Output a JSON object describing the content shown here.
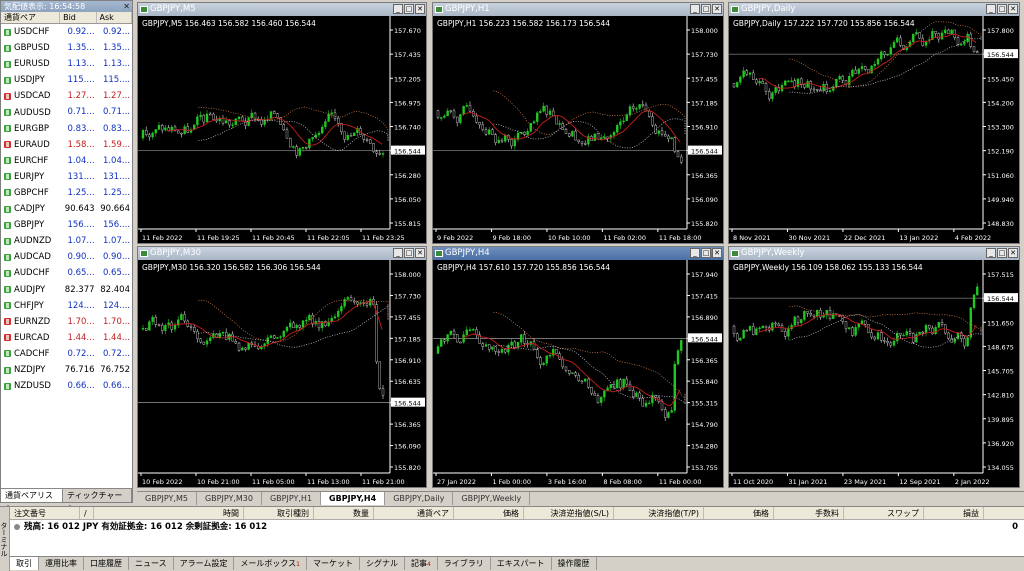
{
  "market_watch": {
    "title": "気配値表示: 16:54:58",
    "col_symbol": "通貨ペア",
    "col_bid": "Bid",
    "col_ask": "Ask",
    "rows": [
      {
        "s": "USDCHF",
        "b": "0.92...",
        "a": "0.92...",
        "dir": "up",
        "col": "blue"
      },
      {
        "s": "GBPUSD",
        "b": "1.35...",
        "a": "1.35...",
        "dir": "up",
        "col": "blue"
      },
      {
        "s": "EURUSD",
        "b": "1.13...",
        "a": "1.13...",
        "dir": "up",
        "col": "blue"
      },
      {
        "s": "USDJPY",
        "b": "115....",
        "a": "115....",
        "dir": "up",
        "col": "blue"
      },
      {
        "s": "USDCAD",
        "b": "1.27...",
        "a": "1.27...",
        "dir": "dn",
        "col": "red"
      },
      {
        "s": "AUDUSD",
        "b": "0.71...",
        "a": "0.71...",
        "dir": "up",
        "col": "blue"
      },
      {
        "s": "EURGBP",
        "b": "0.83...",
        "a": "0.83...",
        "dir": "up",
        "col": "blue"
      },
      {
        "s": "EURAUD",
        "b": "1.58...",
        "a": "1.59...",
        "dir": "dn",
        "col": "red"
      },
      {
        "s": "EURCHF",
        "b": "1.04...",
        "a": "1.04...",
        "dir": "up",
        "col": "blue"
      },
      {
        "s": "EURJPY",
        "b": "131....",
        "a": "131....",
        "dir": "up",
        "col": "blue"
      },
      {
        "s": "GBPCHF",
        "b": "1.25...",
        "a": "1.25...",
        "dir": "up",
        "col": "blue"
      },
      {
        "s": "CADJPY",
        "b": "90.643",
        "a": "90.664",
        "dir": "up",
        "col": "blk"
      },
      {
        "s": "GBPJPY",
        "b": "156....",
        "a": "156....",
        "dir": "up",
        "col": "blue"
      },
      {
        "s": "AUDNZD",
        "b": "1.07...",
        "a": "1.07...",
        "dir": "up",
        "col": "blue"
      },
      {
        "s": "AUDCAD",
        "b": "0.90...",
        "a": "0.90...",
        "dir": "up",
        "col": "blue"
      },
      {
        "s": "AUDCHF",
        "b": "0.65...",
        "a": "0.65...",
        "dir": "up",
        "col": "blue"
      },
      {
        "s": "AUDJPY",
        "b": "82.377",
        "a": "82.404",
        "dir": "up",
        "col": "blk"
      },
      {
        "s": "CHFJPY",
        "b": "124....",
        "a": "124....",
        "dir": "up",
        "col": "blue"
      },
      {
        "s": "EURNZD",
        "b": "1.70...",
        "a": "1.70...",
        "dir": "dn",
        "col": "red"
      },
      {
        "s": "EURCAD",
        "b": "1.44...",
        "a": "1.44...",
        "dir": "dn",
        "col": "red"
      },
      {
        "s": "CADCHF",
        "b": "0.72...",
        "a": "0.72...",
        "dir": "up",
        "col": "blue"
      },
      {
        "s": "NZDJPY",
        "b": "76.716",
        "a": "76.752",
        "dir": "up",
        "col": "blk"
      },
      {
        "s": "NZDUSD",
        "b": "0.66...",
        "a": "0.66...",
        "dir": "up",
        "col": "blue"
      }
    ],
    "tabs": [
      "通貨ペアリスト",
      "ティックチャート"
    ]
  },
  "charts": [
    {
      "title": "GBPJPY,M5",
      "info": "GBPJPY,M5  156.463 156.582 156.460 156.544",
      "active": false,
      "prices": [
        "157.670",
        "157.435",
        "157.205",
        "156.975",
        "156.740",
        "156.544",
        "156.280",
        "156.050",
        "155.815"
      ],
      "times": [
        "11 Feb 2022",
        "11 Feb 19:25",
        "11 Feb 20:45",
        "11 Feb 22:05",
        "11 Feb 23:25"
      ],
      "pmin": 155.8,
      "pmax": 157.8,
      "cur": 156.544,
      "seed": 3
    },
    {
      "title": "GBPJPY,H1",
      "info": "GBPJPY,H1  156.223 156.582 156.173 156.544",
      "active": false,
      "prices": [
        "158.000",
        "157.730",
        "157.455",
        "157.185",
        "156.910",
        "156.544",
        "156.365",
        "156.090",
        "155.820"
      ],
      "times": [
        "9 Feb 2022",
        "9 Feb 18:00",
        "10 Feb 10:00",
        "11 Feb 02:00",
        "11 Feb 18:00"
      ],
      "pmin": 155.8,
      "pmax": 158.1,
      "cur": 156.544,
      "seed": 7
    },
    {
      "title": "GBPJPY,Daily",
      "info": "GBPJPY,Daily  157.222 157.720 155.856 156.544",
      "active": false,
      "prices": [
        "157.800",
        "156.544",
        "155.450",
        "154.200",
        "153.300",
        "152.190",
        "151.060",
        "149.940",
        "148.830"
      ],
      "times": [
        "8 Nov 2021",
        "30 Nov 2021",
        "22 Dec 2021",
        "13 Jan 2022",
        "4 Feb 2022"
      ],
      "pmin": 148.8,
      "pmax": 158.0,
      "cur": 156.544,
      "seed": 11
    },
    {
      "title": "GBPJPY,M30",
      "info": "GBPJPY,M30  156.320 156.582 156.306 156.544",
      "active": false,
      "prices": [
        "158.000",
        "157.730",
        "157.455",
        "157.185",
        "156.910",
        "156.635",
        "156.544",
        "156.365",
        "156.090",
        "155.820"
      ],
      "times": [
        "10 Feb 2022",
        "10 Feb 21:00",
        "11 Feb 05:00",
        "11 Feb 13:00",
        "11 Feb 21:00"
      ],
      "pmin": 155.8,
      "pmax": 158.1,
      "cur": 156.544,
      "seed": 5
    },
    {
      "title": "GBPJPY,H4",
      "info": "GBPJPY,H4  157.610 157.720 155.856 156.544",
      "active": true,
      "prices": [
        "157.940",
        "157.415",
        "156.890",
        "156.544",
        "156.365",
        "155.840",
        "155.315",
        "154.790",
        "154.280",
        "153.755"
      ],
      "times": [
        "27 Jan 2022",
        "1 Feb 00:00",
        "3 Feb 16:00",
        "8 Feb 08:00",
        "11 Feb 00:00"
      ],
      "pmin": 153.6,
      "pmax": 158.1,
      "cur": 156.544,
      "seed": 13
    },
    {
      "title": "GBPJPY,Weekly",
      "info": "GBPJPY,Weekly  156.109 158.062 155.133 156.544",
      "active": false,
      "prices": [
        "157.515",
        "156.544",
        "151.650",
        "148.675",
        "145.705",
        "142.810",
        "139.895",
        "136.920",
        "134.055"
      ],
      "times": [
        "11 Oct 2020",
        "31 Jan 2021",
        "23 May 2021",
        "12 Sep 2021",
        "2 Jan 2022"
      ],
      "pmin": 133.5,
      "pmax": 158.5,
      "cur": 156.544,
      "seed": 17
    }
  ],
  "chart_tabs": [
    "GBPJPY,M5",
    "GBPJPY,M30",
    "GBPJPY,H1",
    "GBPJPY,H4",
    "GBPJPY,Daily",
    "GBPJPY,Weekly"
  ],
  "chart_tab_active": 3,
  "terminal": {
    "headers": [
      "注文番号",
      "/",
      "時間",
      "取引種別",
      "数量",
      "通貨ペア",
      "価格",
      "決済逆指値(S/L)",
      "決済指値(T/P)",
      "価格",
      "手数料",
      "スワップ",
      "損益"
    ],
    "balance": "残高: 16 012 JPY  有効証拠金: 16 012  余剰証拠金: 16 012",
    "pl": "0",
    "side_label": "ターミナル",
    "tabs": [
      {
        "label": "取引",
        "sup": ""
      },
      {
        "label": "運用比率",
        "sup": ""
      },
      {
        "label": "口座履歴",
        "sup": ""
      },
      {
        "label": "ニュース",
        "sup": ""
      },
      {
        "label": "アラーム設定",
        "sup": ""
      },
      {
        "label": "メールボックス",
        "sup": "1"
      },
      {
        "label": "マーケット",
        "sup": ""
      },
      {
        "label": "シグナル",
        "sup": ""
      },
      {
        "label": "記事",
        "sup": "4"
      },
      {
        "label": "ライブラリ",
        "sup": ""
      },
      {
        "label": "エキスパート",
        "sup": ""
      },
      {
        "label": "操作履歴",
        "sup": ""
      }
    ]
  },
  "colors": {
    "bull": "#22c822",
    "bear": "#ffffff",
    "ma": "#c81e1e",
    "cloud": "#e0804a",
    "grid": "#ffffff"
  }
}
